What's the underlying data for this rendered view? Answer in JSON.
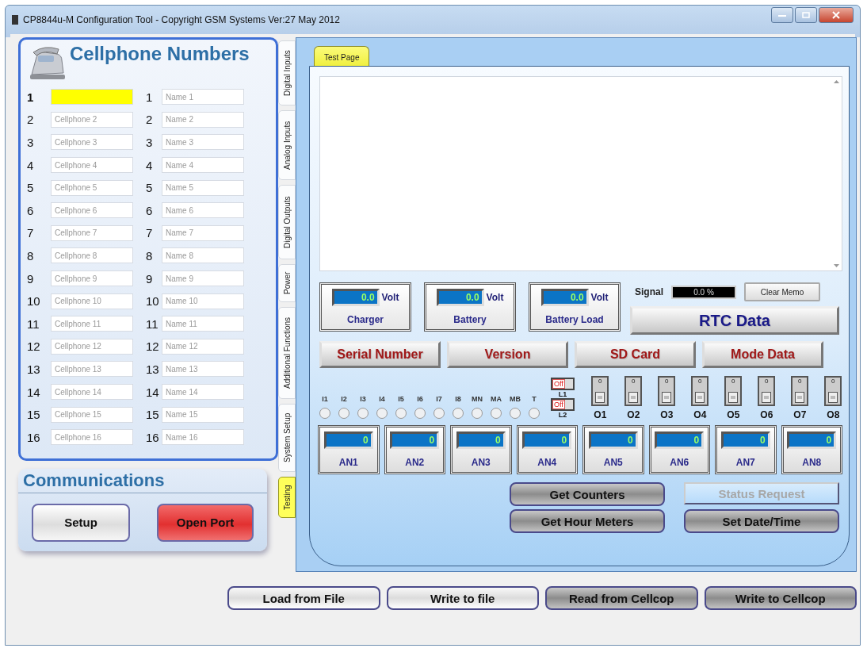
{
  "window": {
    "title": "CP8844u-M Configuration Tool - Copyright GSM Systems Ver:27 May 2012"
  },
  "cellphones": {
    "title": "Cellphone Numbers",
    "rows": [
      {
        "index": "1",
        "focused": true,
        "name_index": "1",
        "name_placeholder": "Name 1"
      },
      {
        "index": "2",
        "focused": false,
        "placeholder": "Cellphone 2",
        "name_index": "2",
        "name_placeholder": "Name 2"
      },
      {
        "index": "3",
        "focused": false,
        "placeholder": "Cellphone 3",
        "name_index": "3",
        "name_placeholder": "Name 3"
      },
      {
        "index": "4",
        "focused": false,
        "placeholder": "Cellphone 4",
        "name_index": "4",
        "name_placeholder": "Name 4"
      },
      {
        "index": "5",
        "focused": false,
        "placeholder": "Cellphone 5",
        "name_index": "5",
        "name_placeholder": "Name 5"
      },
      {
        "index": "6",
        "focused": false,
        "placeholder": "Cellphone 6",
        "name_index": "6",
        "name_placeholder": "Name 6"
      },
      {
        "index": "7",
        "focused": false,
        "placeholder": "Cellphone 7",
        "name_index": "7",
        "name_placeholder": "Name 7"
      },
      {
        "index": "8",
        "focused": false,
        "placeholder": "Cellphone 8",
        "name_index": "8",
        "name_placeholder": "Name 8"
      },
      {
        "index": "9",
        "focused": false,
        "placeholder": "Cellphone 9",
        "name_index": "9",
        "name_placeholder": "Name 9"
      },
      {
        "index": "10",
        "focused": false,
        "placeholder": "Cellphone 10",
        "name_index": "10",
        "name_placeholder": "Name 10"
      },
      {
        "index": "11",
        "focused": false,
        "placeholder": "Cellphone 11",
        "name_index": "11",
        "name_placeholder": "Name 11"
      },
      {
        "index": "12",
        "focused": false,
        "placeholder": "Cellphone 12",
        "name_index": "12",
        "name_placeholder": "Name 12"
      },
      {
        "index": "13",
        "focused": false,
        "placeholder": "Cellphone 13",
        "name_index": "13",
        "name_placeholder": "Name 13"
      },
      {
        "index": "14",
        "focused": false,
        "placeholder": "Cellphone 14",
        "name_index": "14",
        "name_placeholder": "Name 14"
      },
      {
        "index": "15",
        "focused": false,
        "placeholder": "Cellphone 15",
        "name_index": "15",
        "name_placeholder": "Name 15"
      },
      {
        "index": "16",
        "focused": false,
        "placeholder": "Cellphone 16",
        "name_index": "16",
        "name_placeholder": "Name 16"
      }
    ]
  },
  "communications": {
    "title": "Communications",
    "buttons": [
      {
        "label": "Setup",
        "kind": "normal"
      },
      {
        "label": "Open Port",
        "kind": "alert"
      }
    ]
  },
  "side_tabs": [
    {
      "label": "Digital Inputs",
      "selected": false
    },
    {
      "label": "Analog Inputs",
      "selected": false
    },
    {
      "label": "Digital Outputs",
      "selected": false
    },
    {
      "label": "Power",
      "selected": false
    },
    {
      "label": "Additional Functions",
      "selected": false
    },
    {
      "label": "System Setup",
      "selected": false
    },
    {
      "label": "Testing",
      "selected": true
    }
  ],
  "page_tabs": [
    {
      "label": "Test Page",
      "selected": true
    }
  ],
  "voltages": [
    {
      "value": "0.0",
      "unit": "Volt",
      "label": "Charger"
    },
    {
      "value": "0.0",
      "unit": "Volt",
      "label": "Battery"
    },
    {
      "value": "0.0",
      "unit": "Volt",
      "label": "Battery Load"
    }
  ],
  "signal": {
    "label": "Signal",
    "reading": "0.0 %"
  },
  "clear_memo": "Clear Memo",
  "rtc_button": "RTC Data",
  "data_buttons": [
    "Serial Number",
    "Version",
    "SD Card",
    "Mode Data"
  ],
  "inputs": [
    {
      "label": "I1",
      "on": false
    },
    {
      "label": "I2",
      "on": false
    },
    {
      "label": "I3",
      "on": false
    },
    {
      "label": "I4",
      "on": false
    },
    {
      "label": "I5",
      "on": false
    },
    {
      "label": "I6",
      "on": false
    },
    {
      "label": "I7",
      "on": false
    },
    {
      "label": "I8",
      "on": false
    },
    {
      "label": "MN",
      "on": false
    },
    {
      "label": "MA",
      "on": false
    },
    {
      "label": "MB",
      "on": false
    },
    {
      "label": "T",
      "on": false
    }
  ],
  "latches": [
    {
      "state": "Off",
      "on": false,
      "label": "L1"
    },
    {
      "state": "Off",
      "on": false,
      "label": "L2"
    }
  ],
  "outputs": [
    {
      "value": "0",
      "on": false,
      "label": "O1"
    },
    {
      "value": "0",
      "on": false,
      "label": "O2"
    },
    {
      "value": "0",
      "on": false,
      "label": "O3"
    },
    {
      "value": "0",
      "on": false,
      "label": "O4"
    },
    {
      "value": "0",
      "on": false,
      "label": "O5"
    },
    {
      "value": "0",
      "on": false,
      "label": "O6"
    },
    {
      "value": "0",
      "on": false,
      "label": "O7"
    },
    {
      "value": "0",
      "on": false,
      "label": "O8"
    }
  ],
  "analogs": [
    {
      "value": "0",
      "label": "AN1"
    },
    {
      "value": "0",
      "label": "AN2"
    },
    {
      "value": "0",
      "label": "AN3"
    },
    {
      "value": "0",
      "label": "AN4"
    },
    {
      "value": "0",
      "label": "AN5"
    },
    {
      "value": "0",
      "label": "AN6"
    },
    {
      "value": "0",
      "label": "AN7"
    },
    {
      "value": "0",
      "label": "AN8"
    }
  ],
  "actions": [
    {
      "label": "Get Counters",
      "disabled": false
    },
    {
      "label": "Status Request",
      "disabled": true
    },
    {
      "label": "Get Hour Meters",
      "disabled": false
    },
    {
      "label": "Set Date/Time",
      "disabled": false
    }
  ],
  "footer_buttons": [
    {
      "label": "Load from File",
      "kind": "light"
    },
    {
      "label": "Write to file",
      "kind": "light"
    },
    {
      "label": "Read from Cellcop",
      "kind": "dark"
    },
    {
      "label": "Write to Cellcop",
      "kind": "dark"
    }
  ]
}
